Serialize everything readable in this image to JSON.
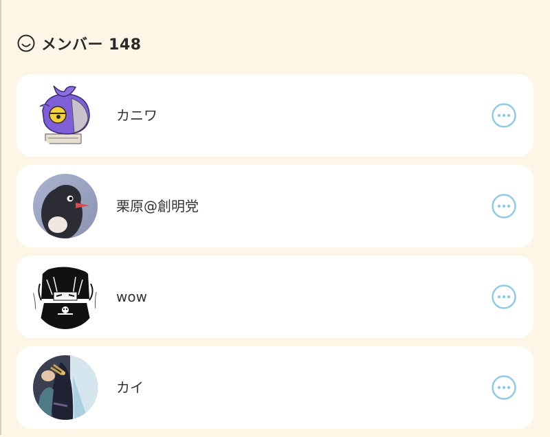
{
  "header": {
    "icon": "smile-face-icon",
    "title": "メンバー 148"
  },
  "members": [
    {
      "name": "カニワ",
      "avatar": "purple-bird-avatar"
    },
    {
      "name": "栗原@創明党",
      "avatar": "penguin-avatar"
    },
    {
      "name": "wow",
      "avatar": "manga-character-avatar"
    },
    {
      "name": "カイ",
      "avatar": "cosplay-photo-avatar"
    }
  ],
  "more_icon": "ellipsis-circle-icon",
  "colors": {
    "background": "#fdf5e6",
    "card": "#ffffff",
    "accent": "#8ecae6",
    "text": "#333333"
  }
}
